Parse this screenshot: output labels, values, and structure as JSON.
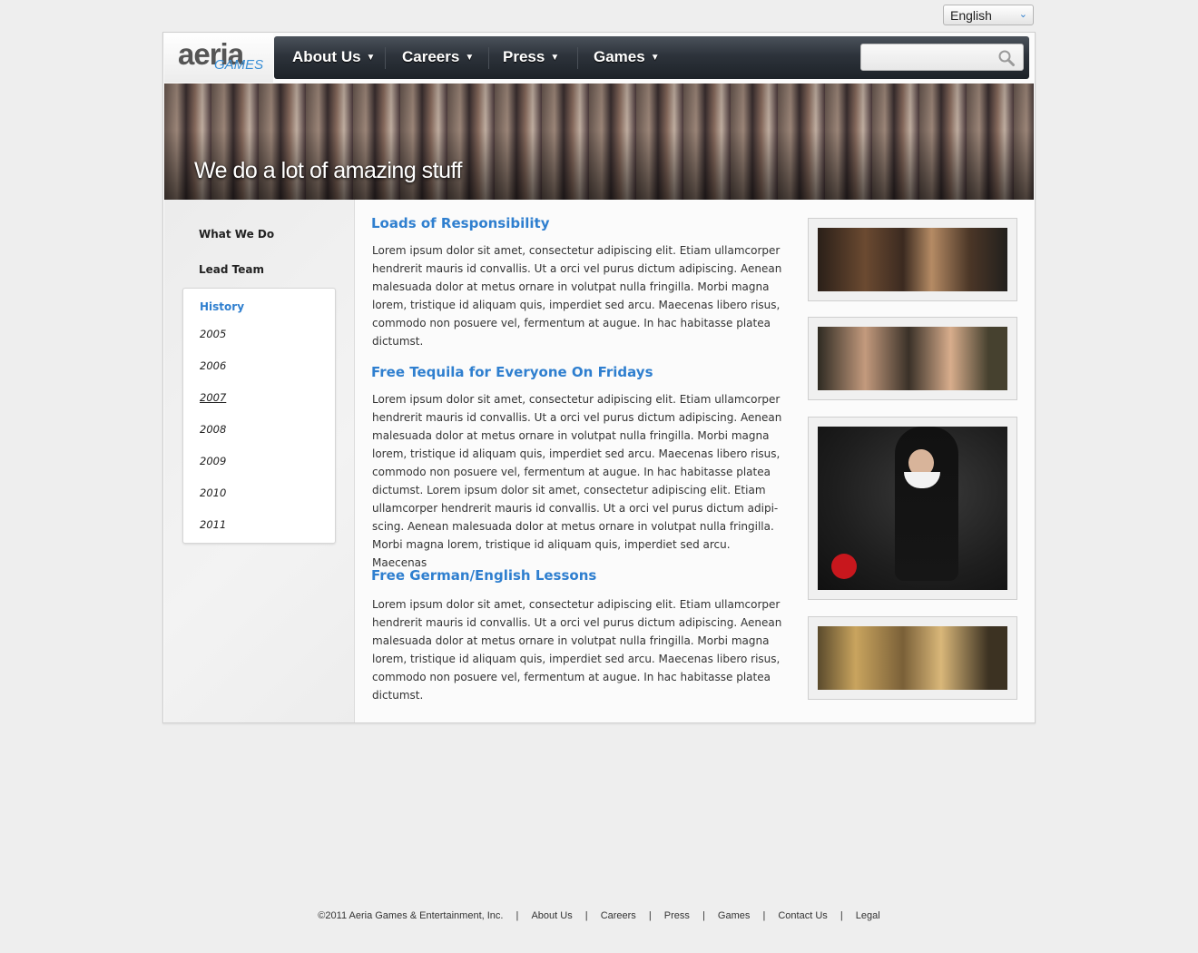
{
  "language": {
    "selected": "English"
  },
  "logo": {
    "main": "aeria",
    "sub": "GAMES"
  },
  "nav": {
    "items": [
      {
        "label": "About Us"
      },
      {
        "label": "Careers"
      },
      {
        "label": "Press"
      },
      {
        "label": "Games"
      }
    ],
    "search_placeholder": ""
  },
  "banner": {
    "title": "We do a lot of amazing stuff"
  },
  "sidebar": {
    "links": [
      {
        "label": "What We Do"
      },
      {
        "label": "Lead Team"
      }
    ],
    "history": {
      "label": "History",
      "years": [
        "2005",
        "2006",
        "2007",
        "2008",
        "2009",
        "2010",
        "2011"
      ],
      "active_year": "2007"
    }
  },
  "content": {
    "sections": [
      {
        "heading": "Loads of Responsibility",
        "lines": [
          "Lorem ipsum dolor sit amet, consectetur adipiscing elit. Etiam ullamcorper",
          "hendrerit mauris id convallis. Ut a orci vel purus dictum adipiscing. Aenean",
          "malesuada dolor at metus ornare in volutpat nulla fringilla. Morbi magna",
          "lorem, tristique id aliquam quis, imperdiet sed arcu. Maecenas libero risus,",
          "commodo non posuere vel, fermentum at augue. In hac habitasse platea",
          "dictumst."
        ]
      },
      {
        "heading": "Free Tequila for Everyone On Fridays",
        "lines": [
          "Lorem ipsum dolor sit amet, consectetur adipiscing elit. Etiam ullamcorper",
          "hendrerit mauris id convallis. Ut a orci vel purus dictum adipiscing. Aenean",
          "malesuada dolor at metus ornare in volutpat nulla fringilla. Morbi magna",
          "lorem, tristique id aliquam quis, imperdiet sed arcu. Maecenas libero risus,",
          "commodo non posuere vel, fermentum at augue. In hac habitasse platea",
          "dictumst. Lorem ipsum dolor sit amet, consectetur adipiscing elit. Etiam",
          "ullamcorper hendrerit mauris id convallis. Ut a orci vel purus dictum adipi-",
          "scing. Aenean malesuada dolor at metus ornare in volutpat nulla fringilla.",
          "Morbi magna lorem, tristique id aliquam quis, imperdiet sed arcu. Maecenas"
        ]
      },
      {
        "heading": "Free German/English Lessons",
        "lines": [
          "Lorem ipsum dolor sit amet, consectetur adipiscing elit. Etiam ullamcorper",
          "hendrerit mauris id convallis. Ut a orci vel purus dictum adipiscing. Aenean",
          "malesuada dolor at metus ornare in volutpat nulla fringilla. Morbi magna",
          "lorem, tristique id aliquam quis, imperdiet sed arcu. Maecenas libero risus,",
          "commodo non posuere vel, fermentum at augue. In hac habitasse platea",
          "dictumst."
        ]
      }
    ]
  },
  "footer": {
    "copyright": "©2011 Aeria Games & Entertainment, Inc.",
    "links": [
      "About Us",
      "Careers",
      "Press",
      "Games",
      "Contact Us",
      "Legal"
    ],
    "separator": "|"
  },
  "colors": {
    "accent": "#2f7fcf",
    "nav_bg": "#2d333b",
    "page_bg": "#eeeeee"
  }
}
